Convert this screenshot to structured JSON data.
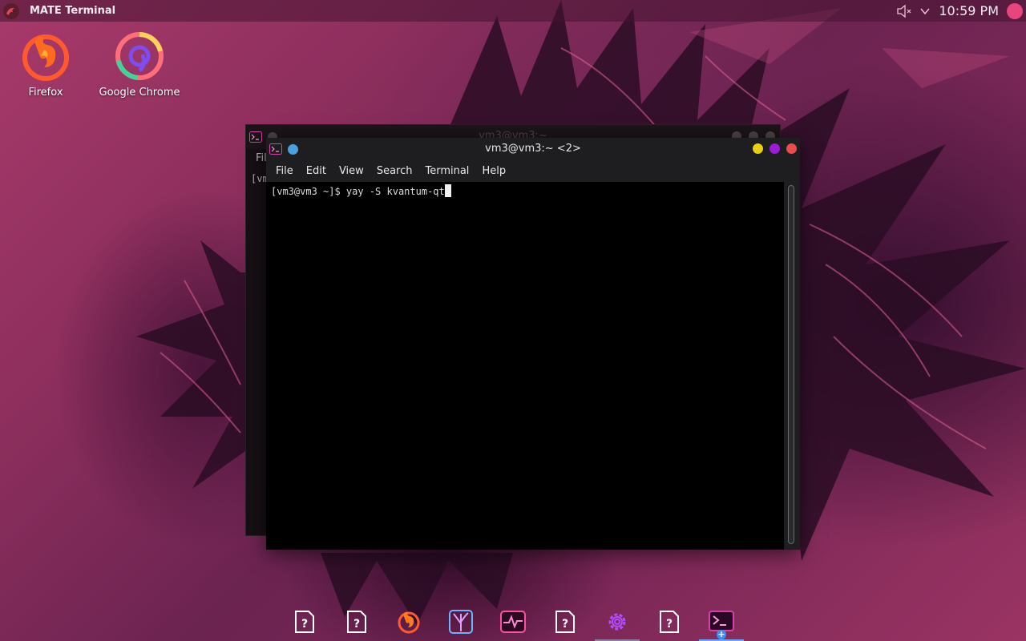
{
  "top_panel": {
    "active_app": "MATE Terminal",
    "clock": "10:59 PM",
    "icons": [
      "app-menu-logo-icon",
      "volume-muted-icon",
      "tray-chevron-icon",
      "user-dot-icon"
    ]
  },
  "desktop": {
    "icons": [
      {
        "label": "Firefox",
        "icon": "firefox-icon"
      },
      {
        "label": "Google Chrome",
        "icon": "chrome-icon"
      }
    ]
  },
  "back_window": {
    "title": "vm3@vm3:~",
    "menu_partial": "Fil",
    "prompt_partial": "[vm"
  },
  "front_window": {
    "title": "vm3@vm3:~ <2>",
    "menu": [
      "File",
      "Edit",
      "View",
      "Search",
      "Terminal",
      "Help"
    ],
    "prompt": "[vm3@vm3 ~]$ yay -S kvantum-qt",
    "buttons": {
      "minimize": "#e9cf10",
      "maximize": "#9d1bd8",
      "close": "#ee4b4b"
    }
  },
  "dock": {
    "items": [
      {
        "icon": "unknown-file-icon"
      },
      {
        "icon": "unknown-file-icon"
      },
      {
        "icon": "firefox-icon"
      },
      {
        "icon": "tree-app-icon"
      },
      {
        "icon": "system-monitor-icon"
      },
      {
        "icon": "unknown-file-icon"
      },
      {
        "icon": "settings-gear-icon"
      },
      {
        "icon": "unknown-file-icon"
      },
      {
        "icon": "terminal-icon"
      }
    ]
  },
  "colors": {
    "accent_pink": "#e8457f",
    "accent_purple": "#9d1bd8",
    "dock_active": "#6aa6ff"
  }
}
